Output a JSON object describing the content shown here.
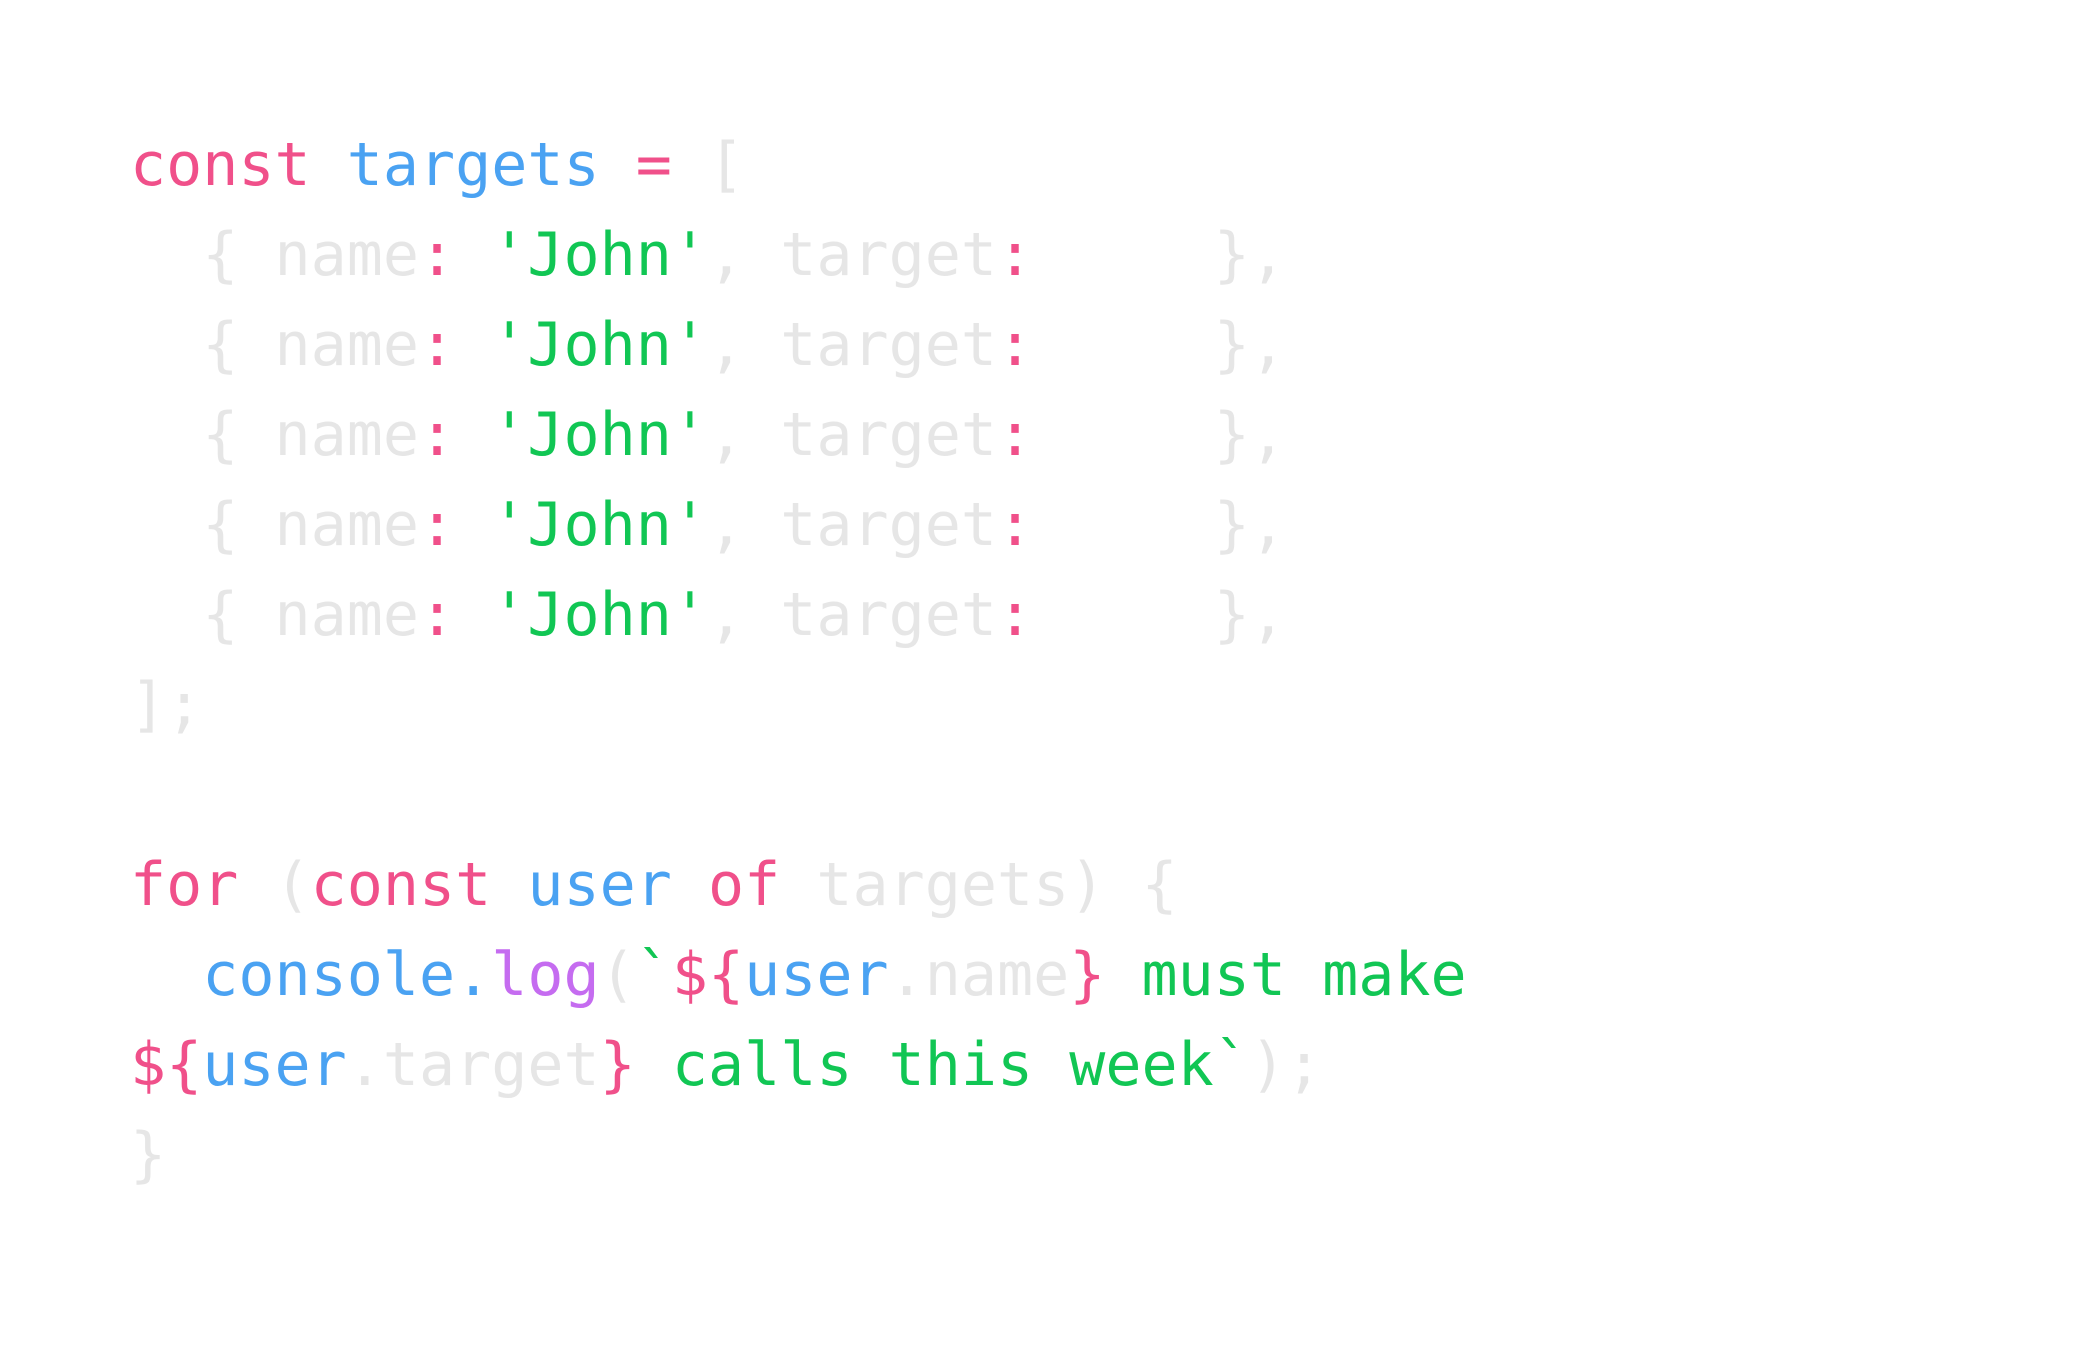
{
  "colors": {
    "keyword": "#f0508a",
    "identifier": "#4aa2f2",
    "string": "#11c654",
    "method": "#c56cf0",
    "dim": "#e6e6e6"
  },
  "code": {
    "lines": [
      {
        "tokens": [
          {
            "text": "const",
            "kind": "keyword"
          },
          {
            "text": " ",
            "kind": "dim"
          },
          {
            "text": "targets",
            "kind": "identifier"
          },
          {
            "text": " ",
            "kind": "dim"
          },
          {
            "text": "=",
            "kind": "keyword"
          },
          {
            "text": " [",
            "kind": "dim"
          }
        ]
      },
      {
        "tokens": [
          {
            "text": "  { name",
            "kind": "dim"
          },
          {
            "text": ":",
            "kind": "keyword"
          },
          {
            "text": " ",
            "kind": "dim"
          },
          {
            "text": "'John'",
            "kind": "string"
          },
          {
            "text": ", target",
            "kind": "dim"
          },
          {
            "text": ":",
            "kind": "keyword"
          },
          {
            "text": "     },",
            "kind": "dim"
          }
        ]
      },
      {
        "tokens": [
          {
            "text": "  { name",
            "kind": "dim"
          },
          {
            "text": ":",
            "kind": "keyword"
          },
          {
            "text": " ",
            "kind": "dim"
          },
          {
            "text": "'John'",
            "kind": "string"
          },
          {
            "text": ", target",
            "kind": "dim"
          },
          {
            "text": ":",
            "kind": "keyword"
          },
          {
            "text": "     },",
            "kind": "dim"
          }
        ]
      },
      {
        "tokens": [
          {
            "text": "  { name",
            "kind": "dim"
          },
          {
            "text": ":",
            "kind": "keyword"
          },
          {
            "text": " ",
            "kind": "dim"
          },
          {
            "text": "'John'",
            "kind": "string"
          },
          {
            "text": ", target",
            "kind": "dim"
          },
          {
            "text": ":",
            "kind": "keyword"
          },
          {
            "text": "     },",
            "kind": "dim"
          }
        ]
      },
      {
        "tokens": [
          {
            "text": "  { name",
            "kind": "dim"
          },
          {
            "text": ":",
            "kind": "keyword"
          },
          {
            "text": " ",
            "kind": "dim"
          },
          {
            "text": "'John'",
            "kind": "string"
          },
          {
            "text": ", target",
            "kind": "dim"
          },
          {
            "text": ":",
            "kind": "keyword"
          },
          {
            "text": "     },",
            "kind": "dim"
          }
        ]
      },
      {
        "tokens": [
          {
            "text": "  { name",
            "kind": "dim"
          },
          {
            "text": ":",
            "kind": "keyword"
          },
          {
            "text": " ",
            "kind": "dim"
          },
          {
            "text": "'John'",
            "kind": "string"
          },
          {
            "text": ", target",
            "kind": "dim"
          },
          {
            "text": ":",
            "kind": "keyword"
          },
          {
            "text": "     },",
            "kind": "dim"
          }
        ]
      },
      {
        "tokens": [
          {
            "text": "];",
            "kind": "dim"
          }
        ]
      },
      {
        "tokens": []
      },
      {
        "tokens": [
          {
            "text": "for",
            "kind": "keyword"
          },
          {
            "text": " (",
            "kind": "dim"
          },
          {
            "text": "const",
            "kind": "keyword"
          },
          {
            "text": " ",
            "kind": "dim"
          },
          {
            "text": "user",
            "kind": "identifier"
          },
          {
            "text": " ",
            "kind": "dim"
          },
          {
            "text": "of",
            "kind": "keyword"
          },
          {
            "text": " targets) {",
            "kind": "dim"
          }
        ]
      },
      {
        "tokens": [
          {
            "text": "  ",
            "kind": "dim"
          },
          {
            "text": "console",
            "kind": "identifier"
          },
          {
            "text": ".",
            "kind": "identifier"
          },
          {
            "text": "log",
            "kind": "method"
          },
          {
            "text": "(",
            "kind": "dim"
          },
          {
            "text": "`",
            "kind": "string"
          },
          {
            "text": "${",
            "kind": "keyword"
          },
          {
            "text": "user",
            "kind": "identifier"
          },
          {
            "text": ".name",
            "kind": "dim"
          },
          {
            "text": "}",
            "kind": "keyword"
          },
          {
            "text": " must make",
            "kind": "string"
          }
        ]
      },
      {
        "tokens": [
          {
            "text": "${",
            "kind": "keyword"
          },
          {
            "text": "user",
            "kind": "identifier"
          },
          {
            "text": ".target",
            "kind": "dim"
          },
          {
            "text": "}",
            "kind": "keyword"
          },
          {
            "text": " calls this week`",
            "kind": "string"
          },
          {
            "text": ");",
            "kind": "dim"
          }
        ]
      },
      {
        "tokens": [
          {
            "text": "}",
            "kind": "dim"
          }
        ]
      }
    ]
  }
}
